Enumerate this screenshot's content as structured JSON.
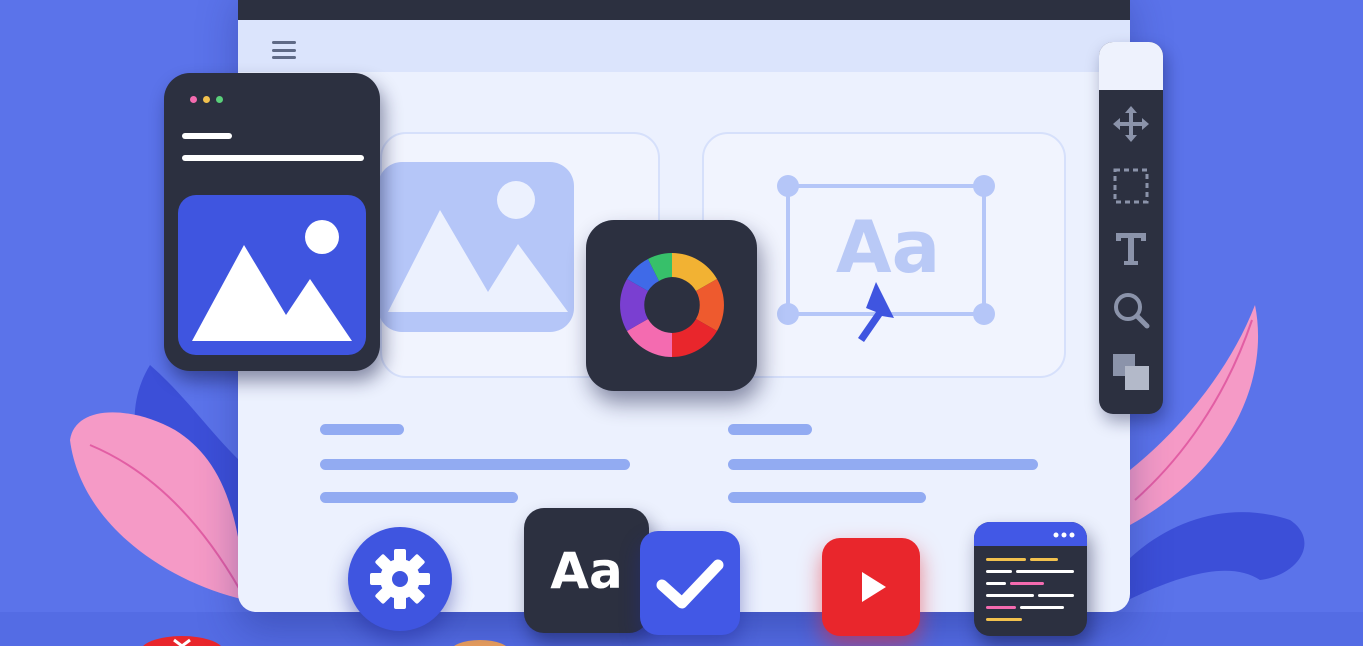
{
  "illustration": {
    "text_card_sample": "Aa",
    "font_tile_sample": "Aa"
  },
  "tool_panel": {
    "tools": [
      "move-icon",
      "marquee-select-icon",
      "text-tool-icon",
      "zoom-icon",
      "layers-icon"
    ]
  },
  "bottom_icons": [
    "gear-icon",
    "font-icon",
    "checkmark-icon",
    "play-icon",
    "code-window-icon"
  ],
  "colors": {
    "background": "#5b73ea",
    "browser_bg": "#ecf1fe",
    "dark_surface": "#2c3040",
    "accent_blue": "#3f55e0",
    "bar_blue": "#92abf2",
    "play_red": "#e9262c",
    "leaf_pink": "#f59ac6",
    "leaf_blue": "#3c4fd8"
  }
}
